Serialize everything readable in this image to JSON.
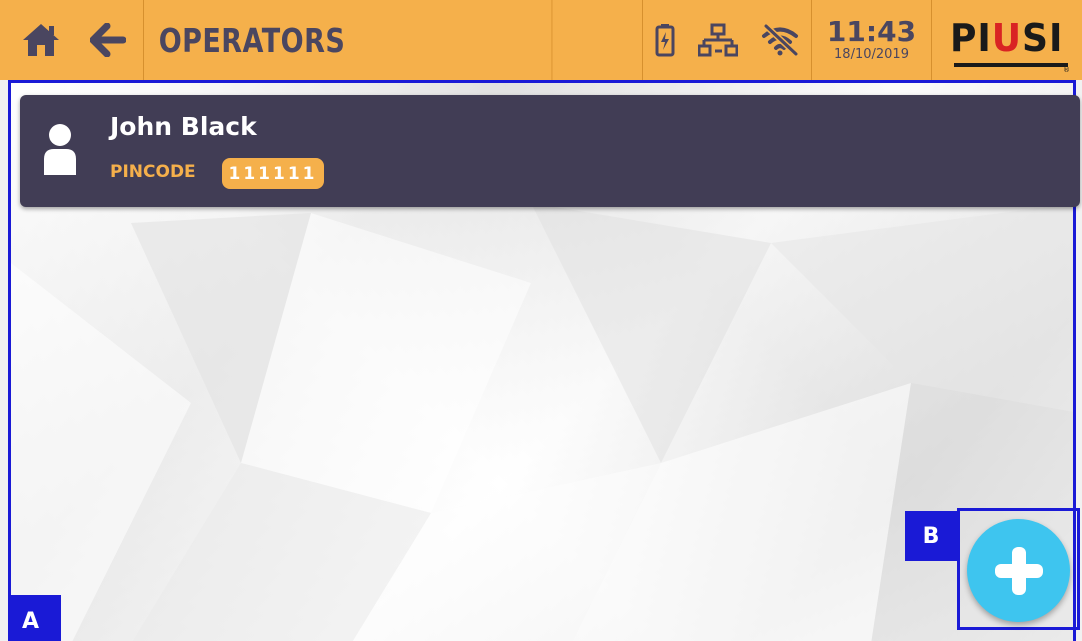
{
  "header": {
    "title": "OPERATORS",
    "time": "11:43",
    "date": "18/10/2019",
    "logo": {
      "part1": "PI",
      "part2": "U",
      "part3": "SI",
      "sub": "® "
    },
    "icons": [
      "home-icon",
      "back-arrow-icon",
      "battery-icon",
      "network-icon",
      "wifi-off-icon"
    ]
  },
  "operators": [
    {
      "name": "John Black",
      "pin_label": "PINCODE",
      "pin": "111111"
    }
  ],
  "annotations": {
    "a": "A",
    "b": "B"
  },
  "colors": {
    "topbar": "#f5b04b",
    "card": "#413d55",
    "accent": "#f5b04b",
    "add_button": "#3ec5ef",
    "annotation": "#1a1ad6"
  }
}
